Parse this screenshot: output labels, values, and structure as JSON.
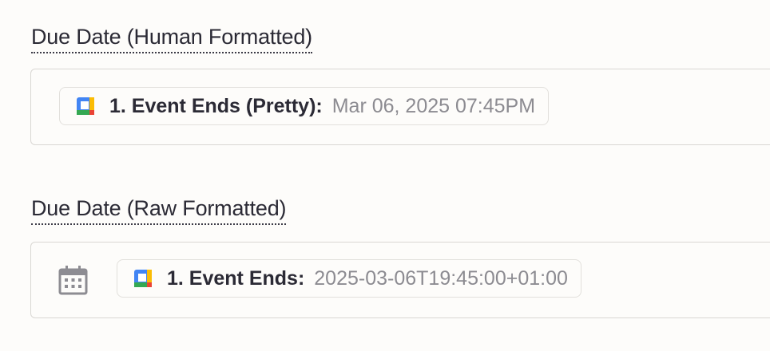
{
  "fields": [
    {
      "label": "Due Date (Human Formatted)",
      "pill": {
        "icon": "google-calendar-icon",
        "key": "1. Event Ends (Pretty):",
        "value": "Mar 06, 2025 07:45PM"
      }
    },
    {
      "label": "Due Date (Raw Formatted)",
      "leading_icon": "calendar-icon",
      "pill": {
        "icon": "google-calendar-icon",
        "key": "1. Event Ends:",
        "value": "2025-03-06T19:45:00+01:00"
      }
    }
  ],
  "colors": {
    "background": "#fdfcfa",
    "border": "#d9d7d3",
    "label_text": "#2b2a35",
    "value_text": "#8c8b91",
    "gcal_blue": "#4285f4",
    "gcal_green": "#34a853",
    "gcal_yellow": "#fbbc04",
    "gcal_red": "#ea4335"
  }
}
